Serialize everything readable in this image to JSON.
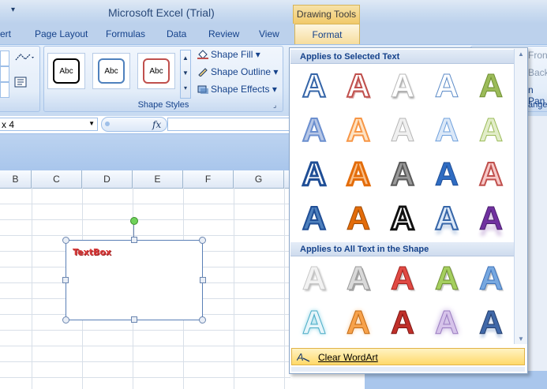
{
  "window": {
    "title": "Microsoft Excel (Trial)",
    "qat_dropdown_icon": "customize-qat-icon",
    "contextual_tab_group": "Drawing Tools"
  },
  "tabs": [
    {
      "label": "ert"
    },
    {
      "label": "Page Layout"
    },
    {
      "label": "Formulas"
    },
    {
      "label": "Data"
    },
    {
      "label": "Review"
    },
    {
      "label": "View"
    },
    {
      "label": "Format",
      "active": true
    }
  ],
  "ribbon": {
    "shape_styles": {
      "label": "Shape Styles",
      "swatches": [
        {
          "text": "Abc",
          "border": "#000000"
        },
        {
          "text": "Abc",
          "border": "#4f81bd"
        },
        {
          "text": "Abc",
          "border": "#c0504d"
        }
      ],
      "shape_fill": "Shape Fill",
      "shape_outline": "Shape Outline",
      "shape_effects": "Shape Effects"
    },
    "arrange_partial": {
      "bring_to_front": "Front",
      "send_to_back": "Back",
      "selection_pane": "n Pan",
      "label": "ange"
    }
  },
  "formula_bar": {
    "name_box": "x 4",
    "fx": "fx",
    "value": ""
  },
  "sheet": {
    "columns": [
      "B",
      "C",
      "D",
      "E",
      "F",
      "G"
    ],
    "textbox_text": "TextBox"
  },
  "wordart_gallery": {
    "section_selected": "Applies to Selected Text",
    "section_all": "Applies to All Text in the Shape",
    "clear_label": "Clear WordArt",
    "glyph": "A"
  },
  "colors": {
    "ribbon_blue": "#c7daf1",
    "text_blue": "#15428b",
    "context_tab": "#f1c96a",
    "highlight": "#ffd96a"
  }
}
